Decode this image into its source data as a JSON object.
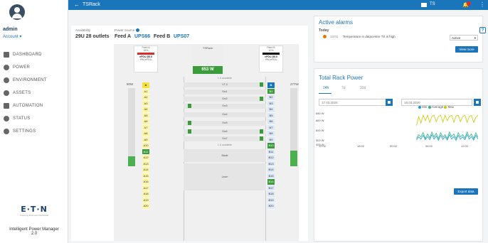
{
  "sidebar": {
    "user": "admin",
    "account": "Account ▾",
    "items": [
      {
        "label": "DASHBOARD",
        "icon": "dashboard-icon"
      },
      {
        "label": "POWER",
        "icon": "power-icon"
      },
      {
        "label": "ENVIRONMENT",
        "icon": "environment-icon"
      },
      {
        "label": "ASSETS",
        "icon": "assets-icon"
      },
      {
        "label": "AUTOMATION",
        "icon": "automation-icon"
      },
      {
        "label": "STATUS",
        "icon": "status-icon"
      },
      {
        "label": "SETTINGS",
        "icon": "settings-icon"
      }
    ],
    "brand": "E·T·N",
    "brand_tag": "Powering Business Worldwide",
    "product": "Intelligent Power Manager",
    "version": "2.0"
  },
  "topbar": {
    "back": "←",
    "title": "TSRack",
    "site": "TS",
    "kebab": "⋮"
  },
  "rack": {
    "availability_label": "Availability",
    "availability_value": "29U  28 outlets",
    "power_source_label": "Power Source",
    "feed_a_label": "Feed A",
    "feed_a_link": "UPS66",
    "feed_b_label": "Feed B",
    "feed_b_link": "UPS07",
    "pdu_a": {
      "title": "Feed A",
      "pct": "15%",
      "name": "ePDU.2B.5",
      "sub": "IPM-ePDU"
    },
    "pdu_b": {
      "title": "Feed B",
      "pct": "10%",
      "name": "ePDU.2B.5",
      "sub": "IPM-ePDU"
    },
    "center_name": "TSRack",
    "power": "653 W",
    "left_watt": "90W",
    "right_watt": "277W",
    "avail_top": "1 U available",
    "avail_mid": "1 U available",
    "col_a_hdr": "A",
    "col_b_hdr": "B",
    "col_a": [
      "A1",
      "A2",
      "A3",
      "A4",
      "A5",
      "A6",
      "A7",
      "A8",
      "A9",
      "A10",
      "A11",
      "A12",
      "A13",
      "A14",
      "A15",
      "A16",
      "A17",
      "A18",
      "A19",
      "A20"
    ],
    "col_b": [
      "B1",
      "B2",
      "B3",
      "B4",
      "B5",
      "B6",
      "B7",
      "B8",
      "B9",
      "B10",
      "B11",
      "B12",
      "B13",
      "B14",
      "B15",
      "B16",
      "B17",
      "B18",
      "B19",
      "B20"
    ],
    "slots": [
      "VT-3",
      "Srv1",
      "Srv2",
      "Srv3",
      "Srv4",
      "Srv5",
      "Srv6",
      "Srv7",
      "Blade",
      "Laser"
    ]
  },
  "alarms": {
    "title": "Active alarms",
    "today": "Today",
    "time": "13:01",
    "text": "Temperature in datacenter TS is high",
    "filter": "Active",
    "view_more": "View more",
    "help": "?"
  },
  "power_chart": {
    "title": "Total Rack Power",
    "tabs": [
      "24h",
      "7d",
      "30d"
    ],
    "date_from": "17.03.2020",
    "date_to": "18.03.2020",
    "export": "Export data",
    "legend": [
      {
        "name": "Min",
        "color": "#1a9ad6"
      },
      {
        "name": "Average",
        "color": "#2fb37a"
      },
      {
        "name": "Max",
        "color": "#c8c800"
      }
    ]
  },
  "chart_data": {
    "type": "line",
    "ylabels": [
      "680 W",
      "660 W",
      "600 W",
      "500 W",
      "400 W"
    ],
    "xlabels": [
      "12:02",
      "18:02",
      "00:02",
      "06:02",
      "12:02"
    ],
    "series": [
      {
        "name": "Max",
        "color": "#c8c800",
        "values": [
          null,
          null,
          null,
          null,
          null,
          null,
          null,
          null,
          null,
          null,
          null,
          null,
          null,
          null,
          null,
          null,
          null,
          null,
          null,
          null,
          null,
          null,
          null,
          null,
          null,
          null,
          null,
          null,
          null,
          null,
          null,
          null,
          null,
          null,
          null,
          null,
          null,
          null,
          null,
          null,
          640,
          668,
          648,
          672,
          655,
          672,
          650,
          668,
          672,
          652,
          668,
          672,
          650,
          672,
          655,
          668,
          672,
          650,
          670,
          672,
          652,
          668,
          672,
          650,
          668,
          672,
          650,
          665,
          672
        ]
      },
      {
        "name": "Average",
        "color": "#2fb37a",
        "values": [
          null,
          null,
          null,
          null,
          null,
          null,
          null,
          null,
          null,
          null,
          null,
          null,
          null,
          null,
          null,
          null,
          null,
          null,
          null,
          null,
          null,
          null,
          null,
          null,
          null,
          null,
          null,
          null,
          null,
          null,
          null,
          null,
          null,
          null,
          null,
          null,
          null,
          null,
          null,
          null,
          600,
          612,
          605,
          618,
          600,
          614,
          602,
          620,
          605,
          616,
          600,
          618,
          604,
          612,
          600,
          620,
          606,
          614,
          600,
          618,
          605,
          612,
          602,
          620,
          605,
          614,
          600,
          618,
          604
        ]
      },
      {
        "name": "Min",
        "color": "#1a9ad6",
        "values": [
          null,
          null,
          null,
          null,
          null,
          null,
          null,
          null,
          null,
          null,
          null,
          null,
          null,
          null,
          null,
          null,
          null,
          null,
          null,
          null,
          null,
          null,
          null,
          null,
          null,
          null,
          null,
          null,
          null,
          null,
          null,
          null,
          null,
          null,
          null,
          null,
          null,
          null,
          null,
          null,
          595,
          605,
          598,
          610,
          596,
          606,
          596,
          612,
          598,
          608,
          594,
          610,
          597,
          606,
          595,
          612,
          598,
          606,
          594,
          610,
          598,
          605,
          596,
          612,
          598,
          606,
          595,
          610,
          598
        ]
      }
    ]
  }
}
